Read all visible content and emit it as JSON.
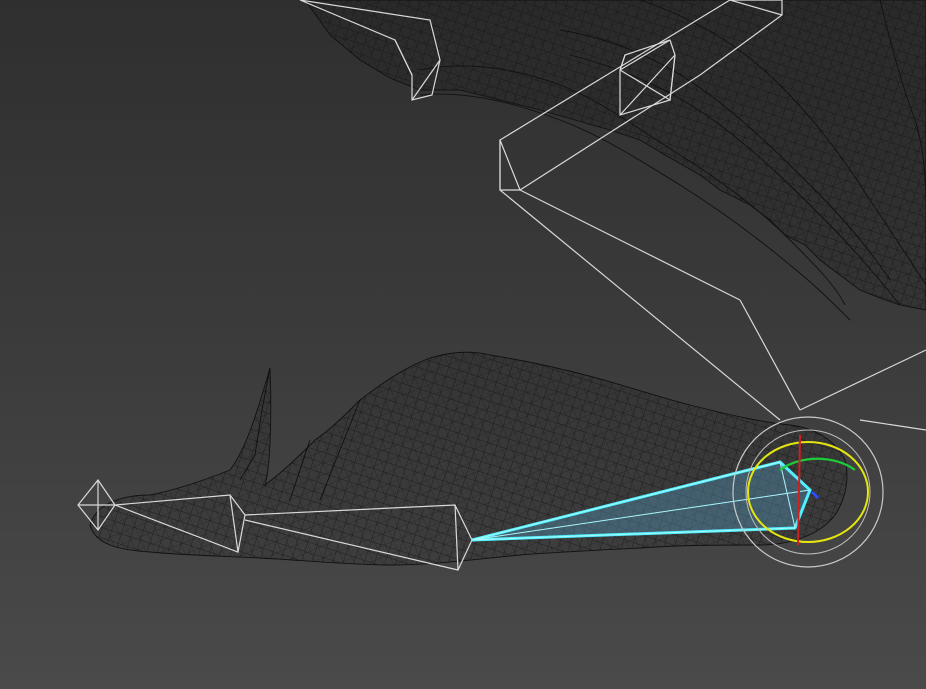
{
  "viewport": {
    "mode": "wireframe",
    "colors": {
      "background_top": "#2f2f2f",
      "background_bottom": "#4a4a4a",
      "mesh_wire": "#111111",
      "bone_wire": "#d9d9d9",
      "selected_bone": "#4ff0ff",
      "gizmo_x": "#d11f1f",
      "gizmo_y": "#1ecb3b",
      "gizmo_z": "#2f49ff",
      "gizmo_ring": "#e5e60f"
    }
  },
  "scene": {
    "selected_bone": "metatarsal",
    "gizmo": "rotate"
  }
}
